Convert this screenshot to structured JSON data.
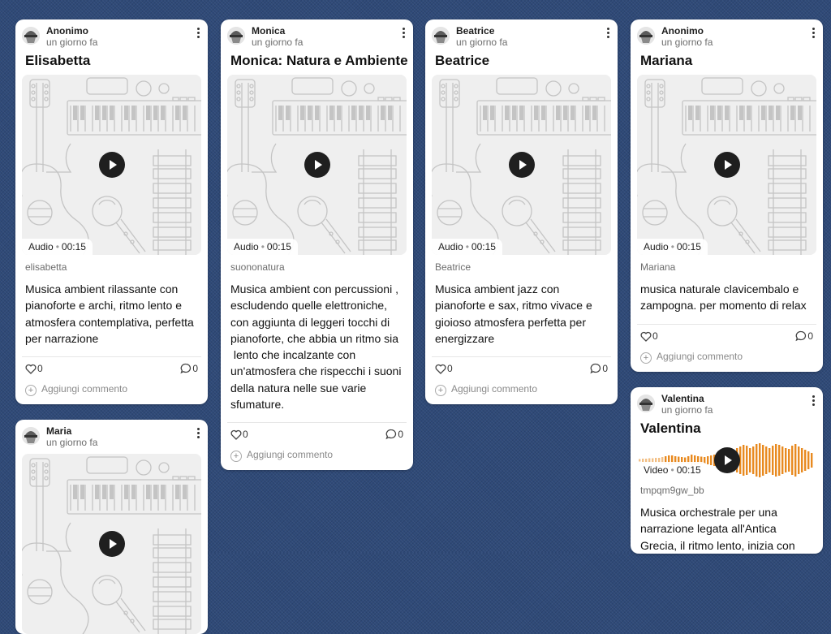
{
  "accent": "#e88a20",
  "cards": [
    {
      "author": "Anonimo",
      "time": "un giorno fa",
      "title": "Elisabetta",
      "media_type": "Audio",
      "duration": "00:15",
      "filename": "elisabetta",
      "body": "Musica ambient rilassante con pianoforte e archi, ritmo lento e atmosfera contemplativa, perfetta per narrazione",
      "likes": "0",
      "comments": "0",
      "add_comment": "Aggiungi commento"
    },
    {
      "author": "Monica",
      "time": "un giorno fa",
      "title": "Monica: Natura e Ambiente",
      "media_type": "Audio",
      "duration": "00:15",
      "filename": "suononatura",
      "body": "Musica ambient con percussioni , escludendo quelle elettroniche, con aggiunta di leggeri tocchi di pianoforte, che abbia un ritmo sia\n lento che incalzante con un'atmosfera che rispecchi i suoni della natura nelle sue varie sfumature.",
      "likes": "0",
      "comments": "0",
      "add_comment": "Aggiungi commento"
    },
    {
      "author": "Beatrice",
      "time": "un giorno fa",
      "title": "Beatrice",
      "media_type": "Audio",
      "duration": "00:15",
      "filename": "Beatrice",
      "body": "Musica ambient jazz con pianoforte e sax, ritmo vivace e gioioso atmosfera perfetta per energizzare",
      "likes": "0",
      "comments": "0",
      "add_comment": "Aggiungi commento"
    },
    {
      "author": "Anonimo",
      "time": "un giorno fa",
      "title": "Mariana",
      "media_type": "Audio",
      "duration": "00:15",
      "filename": "Mariana",
      "body": "musica naturale clavicembalo e zampogna. per momento di relax",
      "likes": "0",
      "comments": "0",
      "add_comment": "Aggiungi commento"
    },
    {
      "author": "Valentina",
      "time": "un giorno fa",
      "title": "Valentina",
      "media_type": "Video",
      "duration": "00:15",
      "filename": "tmpqm9gw_bb",
      "body": "Musica orchestrale per una narrazione legata all'Antica Grecia, il ritmo lento, inizia con",
      "likes": "",
      "comments": "",
      "add_comment": ""
    },
    {
      "author": "Maria",
      "time": "un giorno fa",
      "title": "",
      "media_type": "",
      "duration": "",
      "filename": "",
      "body": "",
      "likes": "",
      "comments": "",
      "add_comment": ""
    }
  ],
  "icons": {
    "avatar": "avatar-icon",
    "menu": "more-vertical-icon",
    "play": "play-icon",
    "like": "heart-icon",
    "comment": "comment-icon",
    "add": "plus-circle-icon"
  }
}
